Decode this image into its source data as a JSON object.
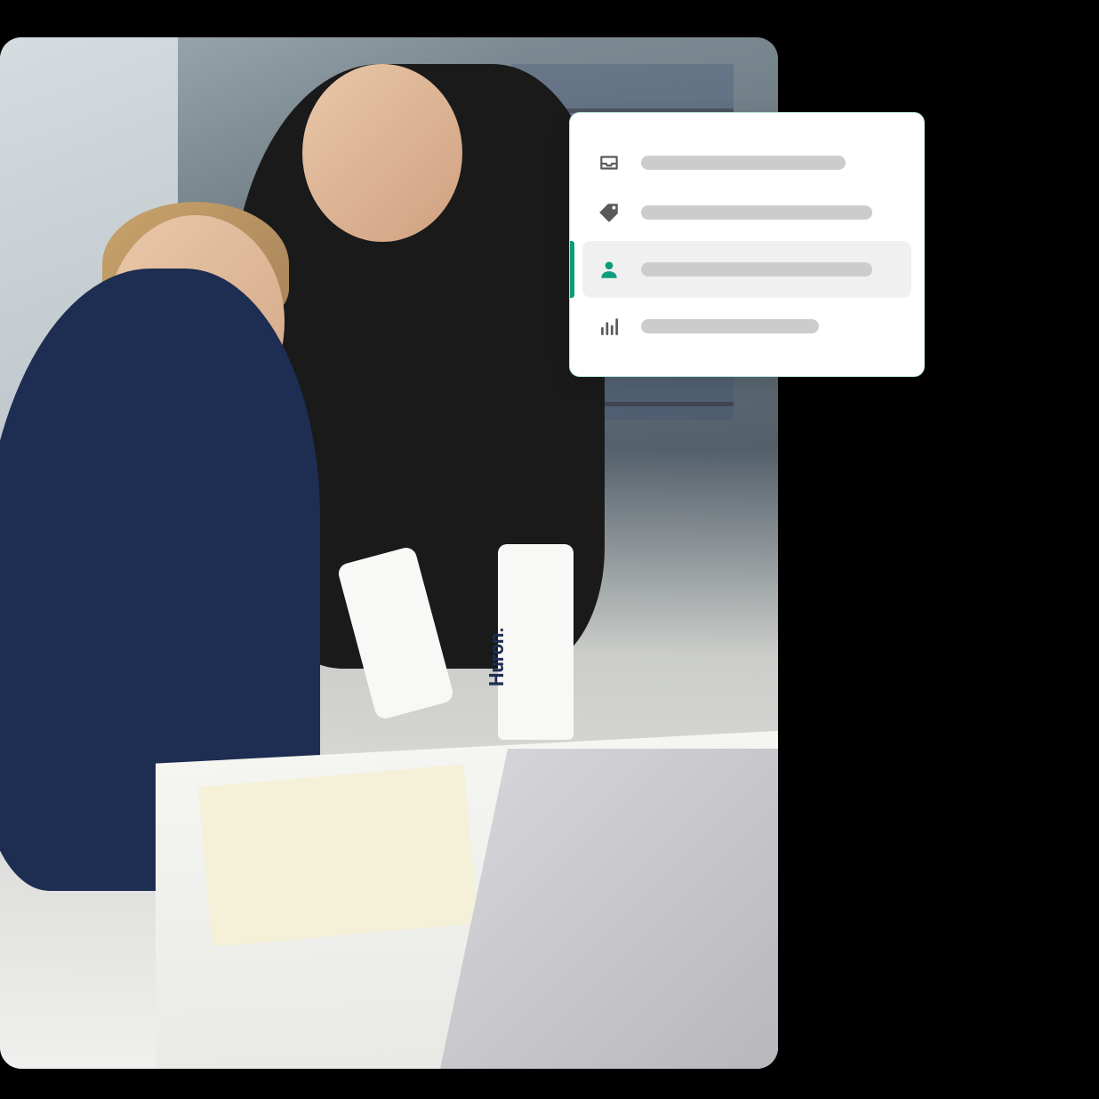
{
  "photo": {
    "product_label": "Huron."
  },
  "nav_card": {
    "items": [
      {
        "icon": "inbox-icon",
        "selected": false,
        "placeholder_width": "medium"
      },
      {
        "icon": "tag-icon",
        "selected": false,
        "placeholder_width": "long"
      },
      {
        "icon": "person-icon",
        "selected": true,
        "placeholder_width": "long"
      },
      {
        "icon": "analytics-icon",
        "selected": false,
        "placeholder_width": "short"
      }
    ],
    "accent_color": "#0c9c7e",
    "placeholder_color": "#cccccc"
  }
}
